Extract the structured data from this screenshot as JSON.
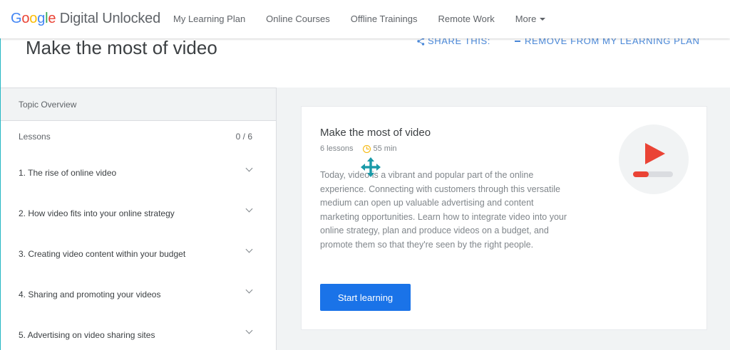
{
  "header": {
    "logo": {
      "google_letters": [
        "G",
        "o",
        "o",
        "g",
        "l",
        "e"
      ],
      "rest": " Digital Unlocked"
    },
    "nav": [
      {
        "label": "My Learning Plan"
      },
      {
        "label": "Online Courses"
      },
      {
        "label": "Offline Trainings"
      },
      {
        "label": "Remote Work"
      },
      {
        "label": "More"
      }
    ]
  },
  "title_row": {
    "title": "Make the most of video",
    "share_label": "SHARE THIS:",
    "remove_label": "REMOVE FROM MY LEARNING PLAN"
  },
  "sidebar": {
    "heading": "Topic Overview",
    "lessons_label": "Lessons",
    "lessons_count": "0 / 6",
    "lessons": [
      {
        "label": "1. The rise of online video"
      },
      {
        "label": "2. How video fits into your online strategy"
      },
      {
        "label": "3. Creating video content within your budget"
      },
      {
        "label": "4. Sharing and promoting your videos"
      },
      {
        "label": "5. Advertising on video sharing sites"
      }
    ]
  },
  "card": {
    "title": "Make the most of video",
    "lesson_count": "6 lessons",
    "duration": "55 min",
    "description": "Today, video is a vibrant and popular part of the online experience. Connecting with customers through this versatile medium can open up valuable advertising and content marketing opportunities. Learn how to integrate video into your online strategy, plan and produce videos on a budget, and promote them so that they're seen by the right people.",
    "button_label": "Start learning"
  },
  "icons": {
    "share": "share-icon",
    "remove": "minus-icon",
    "clock": "clock-icon",
    "video": "video-play-icon",
    "cursor": "move-cursor-icon",
    "chevron": "chevron-down-icon",
    "more_caret": "caret-down-icon"
  },
  "colors": {
    "accent_blue": "#1a73e8",
    "link_blue": "#4a88d8",
    "play_red": "#ea4335",
    "clock_yellow": "#f4b400",
    "cursor_teal": "#1a9aa8"
  }
}
